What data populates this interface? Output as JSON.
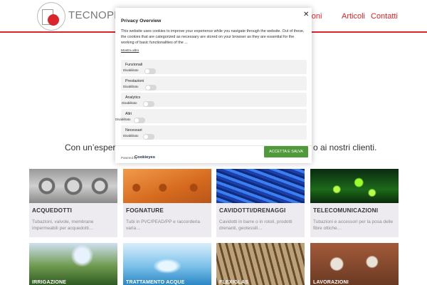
{
  "site": {
    "brand": "TECNOPLASTI",
    "nav": [
      "razioni",
      "Articoli",
      "Contatti"
    ],
    "tagline_left": "Con un’esperien",
    "tagline_right": "o ai nostri clienti."
  },
  "cards": [
    {
      "title": "ACQUEDOTTI",
      "text": "Tubazioni, valvole, membrane impermeabili per acquedotti…"
    },
    {
      "title": "FOGNATURE",
      "text": "Tubi in PVC/PEAD/PP e raccorderia varia…"
    },
    {
      "title": "CAVIDOTTI/DRENAGGI",
      "text": "Cavidotti in barre o in rotoli, prodotti drenanti, geotessili…"
    },
    {
      "title": "TELECOMUNICAZIONI",
      "text": "Tubazioni e accessori per la posa delle fibre ottiche…"
    }
  ],
  "cards_bottom": [
    {
      "title": "IRRIGAZIONE"
    },
    {
      "title": "TRATTAMENTO ACQUE"
    },
    {
      "title": "FLEXIGLAS"
    },
    {
      "title": "LAVORAZIONI"
    }
  ],
  "cookie": {
    "title": "Privacy Overview",
    "close": "✕",
    "description": "This website uses cookies to improve your experience while you navigate through the website. Out of these, the cookies that are categorized as necessary are stored on your browser as they are essential for the working of basic functionalities of the ...",
    "show_more": "Mostra altro",
    "categories": [
      {
        "label": "Funzionali",
        "state": "Disabilitato"
      },
      {
        "label": "Prestazioni",
        "state": "Disabilitato"
      },
      {
        "label": "Analytics",
        "state": "Disabilitato"
      },
      {
        "label": "Altri",
        "state": "Disabilitato"
      },
      {
        "label": "Necessari",
        "state": "Disabilitato"
      }
    ],
    "accept_label": "ACCETTA E SALVA",
    "powered_by": "Powered by",
    "powered_brand": "Cookieyes"
  }
}
